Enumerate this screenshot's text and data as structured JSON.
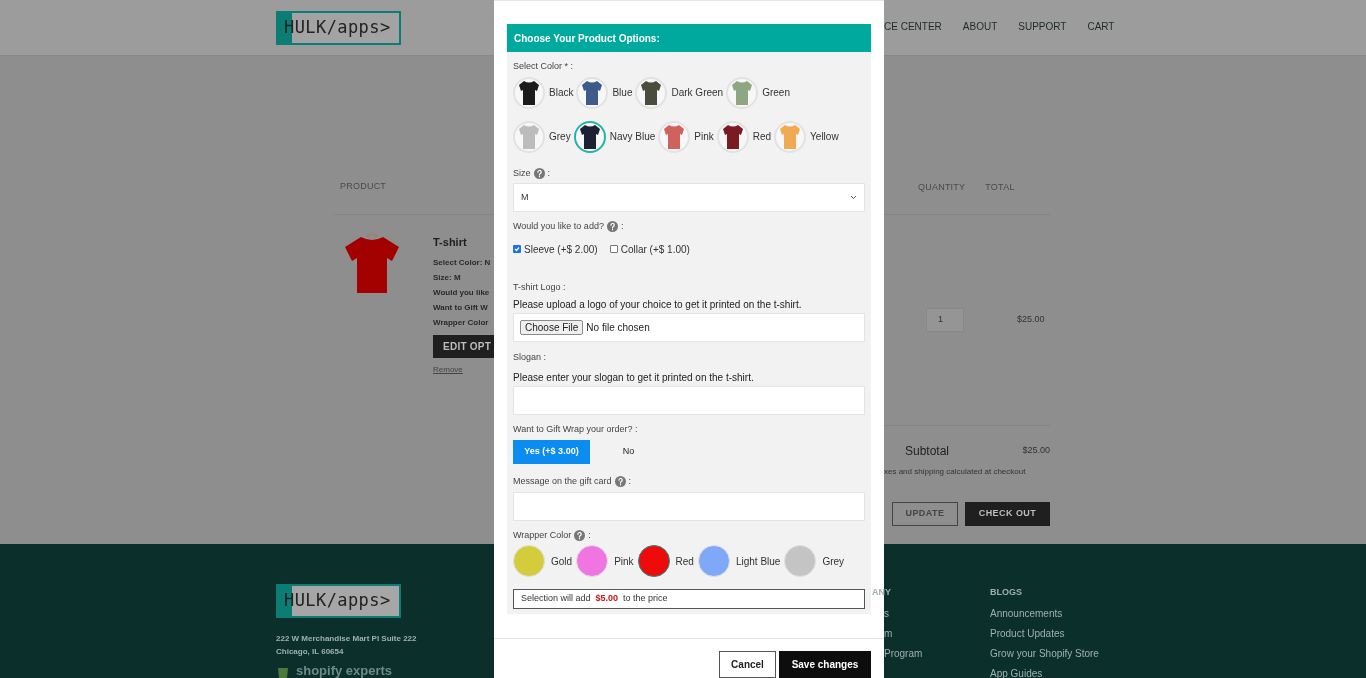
{
  "header": {
    "logo": "HULK/apps>",
    "nav": [
      "CE CENTER",
      "ABOUT",
      "SUPPORT",
      "CART"
    ]
  },
  "cart": {
    "columns": [
      "PRODUCT",
      "QUANTITY",
      "TOTAL"
    ],
    "item": {
      "name": "T-shirt",
      "details": [
        "Select Color: N",
        "Size: M",
        "Would you like",
        "Want to Gift W",
        "Wrapper Color"
      ],
      "edit": "EDIT OPT",
      "remove": "Remove",
      "quantity": "1",
      "total": "$25.00"
    },
    "subtotal_label": "Subtotal",
    "subtotal": "$25.00",
    "note": "xes and shipping calculated at checkout",
    "update": "UPDATE",
    "checkout": "CHECK OUT"
  },
  "footer": {
    "logo": "HULK/apps>",
    "address": [
      "222 W Merchandise Mart Pl Suite 222",
      "Chicago, IL 60654"
    ],
    "badge": "shopify experts",
    "company_heading": "ANY",
    "company_links": [
      "s",
      "m",
      "Program"
    ],
    "blogs_heading": "BLOGS",
    "blogs": [
      "Announcements",
      "Product Updates",
      "Grow your Shopify Store",
      "App Guides"
    ]
  },
  "modal": {
    "title": "Choose Your Product Options:",
    "color_label": "Select Color * :",
    "colors": [
      {
        "name": "Black",
        "color": "#1c1c1c",
        "selected": false
      },
      {
        "name": "Blue",
        "color": "#3e5a8c",
        "selected": false
      },
      {
        "name": "Dark Green",
        "color": "#4a4d3c",
        "selected": false
      },
      {
        "name": "Green",
        "color": "#8fa683",
        "selected": false
      },
      {
        "name": "Grey",
        "color": "#bcbcbc",
        "selected": false
      },
      {
        "name": "Navy Blue",
        "color": "#1c2233",
        "selected": true
      },
      {
        "name": "Pink",
        "color": "#d0625d",
        "selected": false
      },
      {
        "name": "Red",
        "color": "#7a1a22",
        "selected": false
      },
      {
        "name": "Yellow",
        "color": "#efaa52",
        "selected": false
      }
    ],
    "size": {
      "label": "Size",
      "suffix": ":",
      "value": "M"
    },
    "addons": {
      "label": "Would you like to add?",
      "suffix": ":",
      "options": [
        {
          "label": "Sleeve (+$ 2.00)",
          "checked": true
        },
        {
          "label": "Collar (+$ 1.00)",
          "checked": false
        }
      ]
    },
    "logo_upload": {
      "label": "T-shirt Logo :",
      "hint": "Please upload a logo of your choice to get it printed on the t-shirt.",
      "button": "Choose File",
      "status": "No file chosen"
    },
    "slogan": {
      "label": "Slogan :",
      "hint": "Please enter your slogan to get it printed on the t-shirt."
    },
    "gift_wrap": {
      "label": "Want to Gift Wrap your order? :",
      "options": [
        {
          "label": "Yes (+$ 3.00)",
          "selected": true
        },
        {
          "label": "No",
          "selected": false
        }
      ]
    },
    "gift_message": {
      "label": "Message on the gift card",
      "suffix": ":"
    },
    "wrapper": {
      "label": "Wrapper Color",
      "suffix": ":",
      "colors": [
        {
          "name": "Gold",
          "color": "#d4cc3c",
          "selected": false
        },
        {
          "name": "Pink",
          "color": "#f075e0",
          "selected": false
        },
        {
          "name": "Red",
          "color": "#f00a0a",
          "selected": true
        },
        {
          "name": "Light Blue",
          "color": "#7fa8f8",
          "selected": false
        },
        {
          "name": "Grey",
          "color": "#c4c4c4",
          "selected": false
        }
      ]
    },
    "summary": {
      "prefix": "Selection will add",
      "amount": "$5.00",
      "suffix": "to the price"
    },
    "cancel": "Cancel",
    "save": "Save changes"
  }
}
